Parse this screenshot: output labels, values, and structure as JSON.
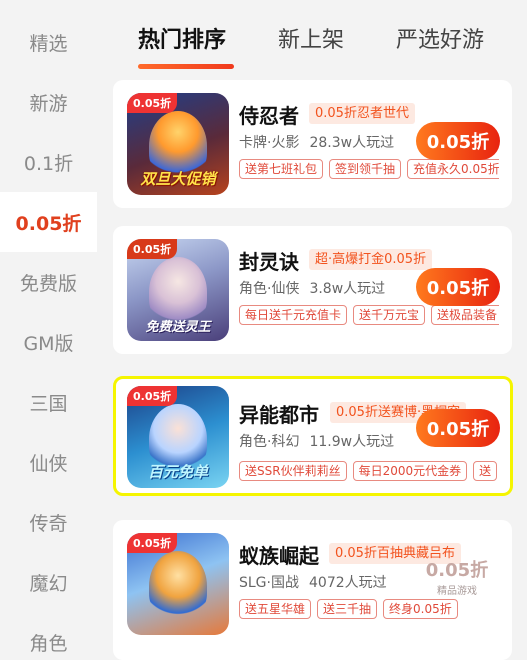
{
  "sidebar": {
    "items": [
      {
        "label": "精选",
        "active": false
      },
      {
        "label": "新游",
        "active": false
      },
      {
        "label": "0.1折",
        "active": false
      },
      {
        "label": "0.05折",
        "active": true
      },
      {
        "label": "免费版",
        "active": false
      },
      {
        "label": "GM版",
        "active": false
      },
      {
        "label": "三国",
        "active": false
      },
      {
        "label": "仙侠",
        "active": false
      },
      {
        "label": "传奇",
        "active": false
      },
      {
        "label": "魔幻",
        "active": false
      },
      {
        "label": "角色",
        "active": false
      }
    ]
  },
  "tabs": [
    {
      "label": "热门排序",
      "active": true
    },
    {
      "label": "新上架",
      "active": false
    },
    {
      "label": "严选好游",
      "active": false
    }
  ],
  "games": [
    {
      "name": "侍忍者",
      "promo": "0.05折忍者世代",
      "category": "卡牌·火影",
      "players": "28.3w人玩过",
      "tags": [
        "送第七班礼包",
        "签到领千抽",
        "充值永久0.05折"
      ],
      "discount": "0.05折",
      "thumb_badge": "0.05折",
      "thumb_banner": "双旦大促销"
    },
    {
      "name": "封灵诀",
      "promo": "超·高爆打金0.05折",
      "category": "角色·仙侠",
      "players": "3.8w人玩过",
      "tags": [
        "每日送千元充值卡",
        "送千万元宝",
        "送极品装备"
      ],
      "discount": "0.05折",
      "thumb_badge": "0.05折",
      "thumb_banner": "免费送灵王"
    },
    {
      "name": "异能都市",
      "promo": "0.05折送赛博·黑桐究",
      "category": "角色·科幻",
      "players": "11.9w人玩过",
      "tags": [
        "送SSR伙伴莉莉丝",
        "每日2000元代金券",
        "送"
      ],
      "discount": "0.05折",
      "thumb_badge": "0.05折",
      "thumb_banner": "百元免单"
    },
    {
      "name": "蚁族崛起",
      "promo": "0.05折百抽典藏吕布",
      "category": "SLG·国战",
      "players": "4072人玩过",
      "tags": [
        "送五星华雄",
        "送三千抽",
        "终身0.05折"
      ],
      "discount": "0.05折",
      "seal_sub": "精品游戏",
      "thumb_badge": "0.05折"
    }
  ],
  "colors": {
    "accent": "#e0401e",
    "button_gradient_start": "#ff7a1e",
    "button_gradient_end": "#e8230f",
    "highlight_border": "#f5f500"
  }
}
